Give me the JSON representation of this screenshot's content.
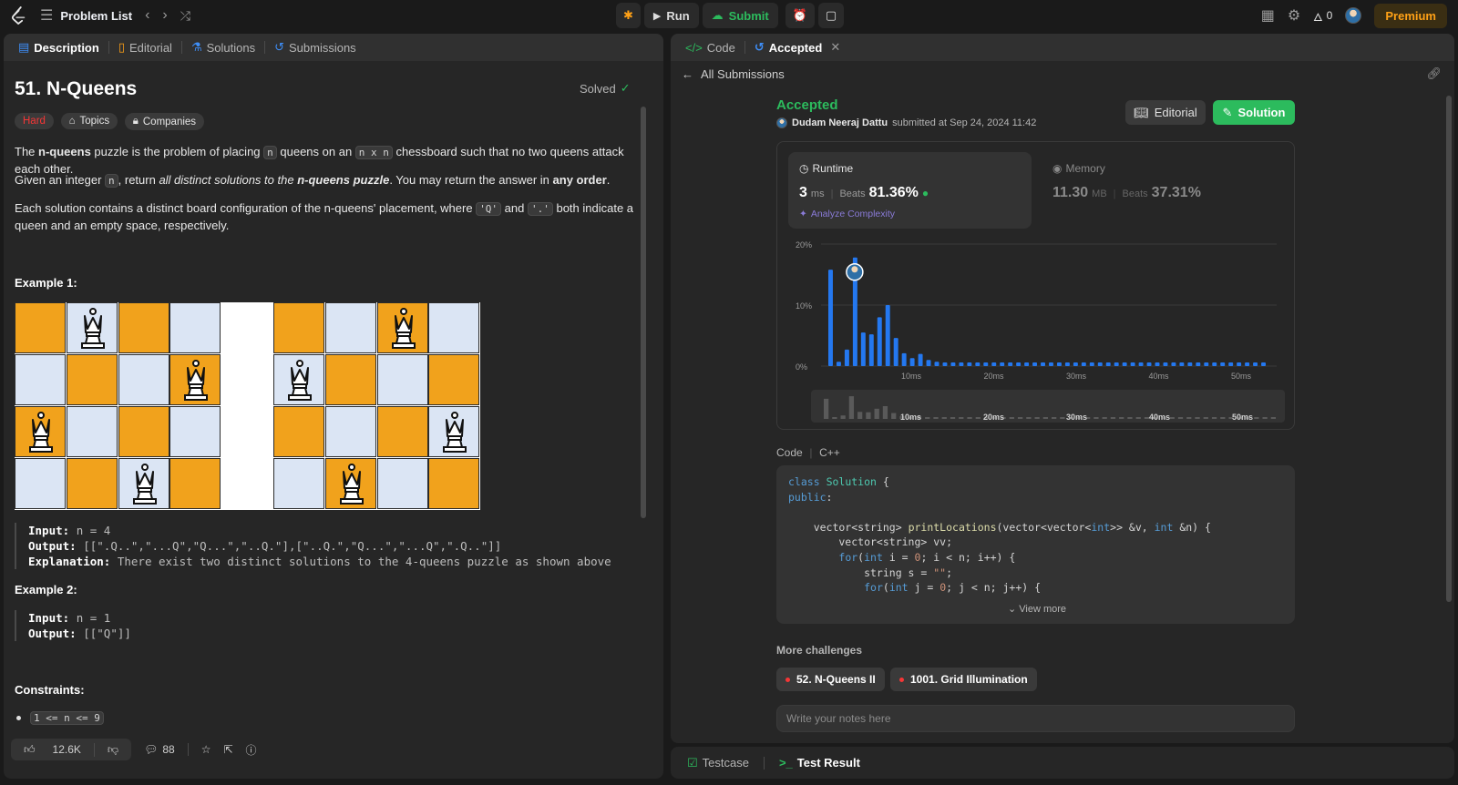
{
  "topbar": {
    "problem_list": "Problem List",
    "run": "Run",
    "submit": "Submit",
    "streak": "0",
    "premium": "Premium"
  },
  "left_tabs": [
    "Description",
    "Editorial",
    "Solutions",
    "Submissions"
  ],
  "problem": {
    "title": "51. N-Queens",
    "solved": "Solved",
    "difficulty": "Hard",
    "topics": "Topics",
    "companies": "Companies",
    "p1_a": "The ",
    "p1_b": "n-queens",
    "p1_c": " puzzle is the problem of placing ",
    "p1_code1": "n",
    "p1_d": " queens on an ",
    "p1_code2": "n x n",
    "p1_e": " chessboard such that no two queens attack each other.",
    "p2_a": "Given an integer ",
    "p2_code": "n",
    "p2_b": ", return ",
    "p2_c": "all distinct solutions to the ",
    "p2_d": "n-queens puzzle",
    "p2_e": ". You may return the answer in ",
    "p2_f": "any order",
    "p2_g": ".",
    "p3_a": "Each solution contains a distinct board configuration of the n-queens' placement, where ",
    "p3_code1": "'Q'",
    "p3_b": " and ",
    "p3_code2": "'.'",
    "p3_c": " both indicate a queen and an empty space, respectively.",
    "example1_title": "Example 1:",
    "ex1_input_label": "Input:",
    "ex1_input": "n = 4",
    "ex1_output_label": "Output:",
    "ex1_output": "[[\".Q..\",\"...Q\",\"Q...\",\"..Q.\"],[\"..Q.\",\"Q...\",\"...Q\",\".Q..\"]]",
    "ex1_expl_label": "Explanation:",
    "ex1_expl": "There exist two distinct solutions to the 4-queens puzzle as shown above",
    "example2_title": "Example 2:",
    "ex2_input_label": "Input:",
    "ex2_input": "n = 1",
    "ex2_output_label": "Output:",
    "ex2_output": "[[\"Q\"]]",
    "constraints_title": "Constraints:",
    "constraint1": "1 <= n <= 9"
  },
  "left_footer": {
    "likes": "12.6K",
    "comments": "88"
  },
  "right_tabs": [
    "Code",
    "Accepted"
  ],
  "submission": {
    "back": "All Submissions",
    "status": "Accepted",
    "user": "Dudam Neeraj Dattu",
    "submitted_at": "submitted at Sep 24, 2024 11:42",
    "editorial_btn": "Editorial",
    "solution_btn": "Solution",
    "runtime_label": "Runtime",
    "runtime_value": "3",
    "runtime_unit": "ms",
    "beats_label": "Beats",
    "runtime_beats": "81.36%",
    "analyze": "Analyze Complexity",
    "memory_label": "Memory",
    "memory_value": "11.30",
    "memory_unit": "MB",
    "memory_beats": "37.31%",
    "code_label": "Code",
    "lang": "C++",
    "view_more": "View more",
    "more_challenges": "More challenges",
    "challenge1": "52. N-Queens II",
    "challenge2": "1001. Grid Illumination",
    "notes_placeholder": "Write your notes here"
  },
  "chart_data": {
    "type": "bar",
    "ylim": [
      0,
      20
    ],
    "y_ticks": [
      "20%",
      "10%",
      "0%"
    ],
    "x_ticks": [
      "10ms",
      "20ms",
      "30ms",
      "40ms",
      "50ms"
    ],
    "values": [
      15.8,
      0.7,
      2.7,
      17.8,
      5.5,
      5.2,
      8.0,
      10.0,
      4.6,
      2.1,
      1.3,
      2.0,
      1.0,
      0.7,
      0.6,
      0.6,
      0.6,
      0.6,
      0.6,
      0.6,
      0.6,
      0.6,
      0.6,
      0.6,
      0.6,
      0.6,
      0.6,
      0.6,
      0.6,
      0.6,
      0.6,
      0.6,
      0.6,
      0.6,
      0.6,
      0.6,
      0.6,
      0.6,
      0.6,
      0.6,
      0.6,
      0.6,
      0.6,
      0.6,
      0.6,
      0.6,
      0.6,
      0.6,
      0.6,
      0.6,
      0.6,
      0.6,
      0.6,
      0.6
    ],
    "highlight_index": 3,
    "bar_color": "#2478f0"
  },
  "bottom_tabs": [
    "Testcase",
    "Test Result"
  ],
  "colors": {
    "accent": "#ffa116",
    "green": "#2cbb5d",
    "hard": "#f63636"
  }
}
